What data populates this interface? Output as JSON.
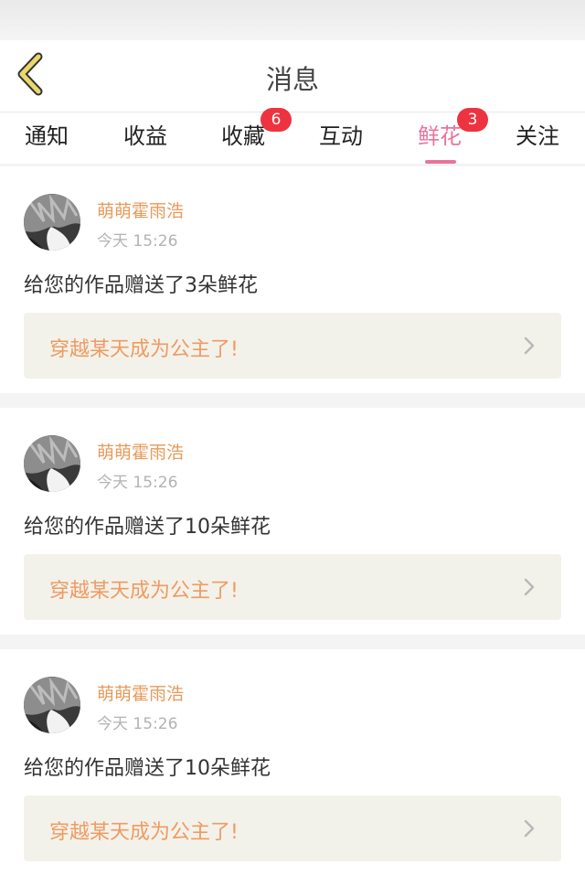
{
  "header": {
    "title": "消息"
  },
  "tabs": [
    {
      "label": "通知",
      "badge": "",
      "active": false
    },
    {
      "label": "收益",
      "badge": "",
      "active": false
    },
    {
      "label": "收藏",
      "badge": "6",
      "active": false
    },
    {
      "label": "互动",
      "badge": "",
      "active": false
    },
    {
      "label": "鲜花",
      "badge": "3",
      "active": true
    },
    {
      "label": "关注",
      "badge": "",
      "active": false
    }
  ],
  "messages": [
    {
      "sender": "萌萌霍雨浩",
      "time": "今天 15:26",
      "text": "给您的作品赠送了3朵鲜花",
      "work_title": "穿越某天成为公主了!"
    },
    {
      "sender": "萌萌霍雨浩",
      "time": "今天 15:26",
      "text": "给您的作品赠送了10朵鲜花",
      "work_title": "穿越某天成为公主了!"
    },
    {
      "sender": "萌萌霍雨浩",
      "time": "今天 15:26",
      "text": "给您的作品赠送了10朵鲜花",
      "work_title": "穿越某天成为公主了!"
    }
  ],
  "icons": {
    "back": "chevron-left-icon",
    "avatar": "avatar-image",
    "arrow": "chevron-right-icon"
  },
  "colors": {
    "accent": "#e8749b",
    "badge": "#ee3340",
    "sender": "#e79a5b",
    "work_title": "#ef9b63",
    "back_icon": "#e9d86a"
  }
}
